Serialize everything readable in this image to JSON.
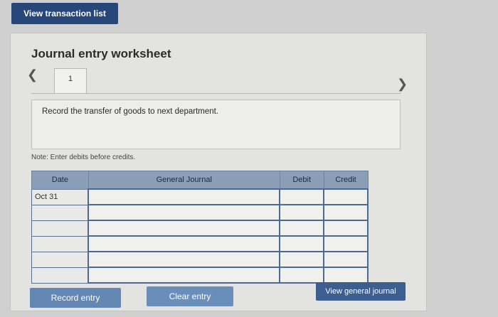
{
  "header": {
    "view_transaction_list": "View transaction list"
  },
  "worksheet": {
    "title": "Journal entry worksheet",
    "tab_number": "1",
    "instruction": "Record the transfer of goods to next department.",
    "note": "Note: Enter debits before credits."
  },
  "table": {
    "headers": {
      "date": "Date",
      "journal": "General Journal",
      "debit": "Debit",
      "credit": "Credit"
    },
    "rows": [
      {
        "date": "Oct 31",
        "journal": "",
        "debit": "",
        "credit": ""
      },
      {
        "date": "",
        "journal": "",
        "debit": "",
        "credit": ""
      },
      {
        "date": "",
        "journal": "",
        "debit": "",
        "credit": ""
      },
      {
        "date": "",
        "journal": "",
        "debit": "",
        "credit": ""
      },
      {
        "date": "",
        "journal": "",
        "debit": "",
        "credit": ""
      },
      {
        "date": "",
        "journal": "",
        "debit": "",
        "credit": ""
      }
    ]
  },
  "footer": {
    "record_entry": "Record entry",
    "clear_entry": "Clear entry",
    "view_general_journal": "View general journal"
  }
}
